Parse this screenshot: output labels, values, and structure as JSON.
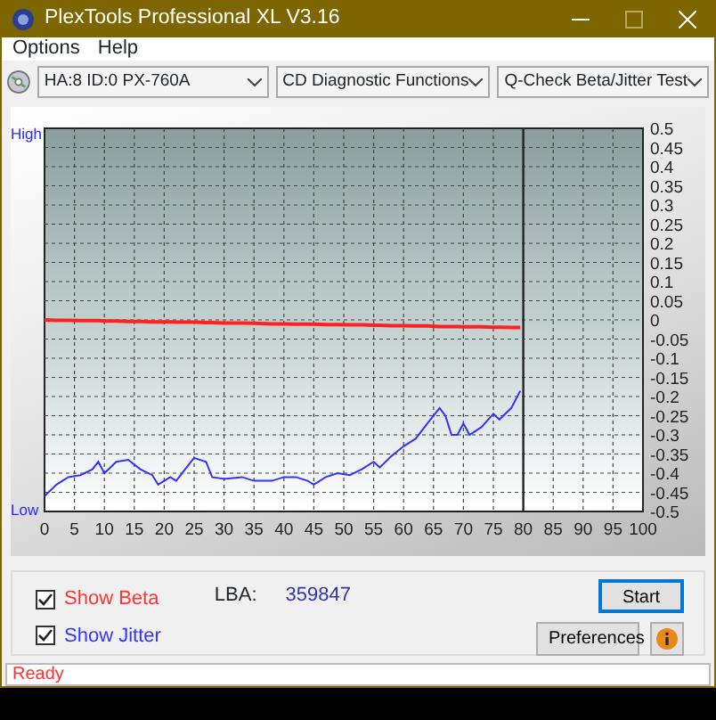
{
  "window": {
    "title": "PlexTools Professional XL V3.16"
  },
  "menu": [
    {
      "label": "Options"
    },
    {
      "label": "Help"
    }
  ],
  "toolbar": [
    {
      "value": "HA:8 ID:0  PX-760A"
    },
    {
      "value": "CD Diagnostic Functions"
    },
    {
      "value": "Q-Check Beta/Jitter Test"
    }
  ],
  "chart": {
    "high_label": "High",
    "low_label": "Low",
    "chart_data": {
      "type": "line",
      "grid": true,
      "ref_lines": [
        {
          "axis": "x",
          "value": 80,
          "color": "#222222"
        }
      ],
      "xlim": [
        0,
        100
      ],
      "ylim": [
        -0.5,
        0.5
      ],
      "xticks": [
        0,
        5,
        10,
        15,
        20,
        25,
        30,
        35,
        40,
        45,
        50,
        55,
        60,
        65,
        70,
        75,
        80,
        85,
        90,
        95,
        100
      ],
      "yticks": [
        0.5,
        0.45,
        0.4,
        0.35,
        0.3,
        0.25,
        0.2,
        0.15,
        0.1,
        0.05,
        0,
        -0.05,
        -0.1,
        -0.15,
        -0.2,
        -0.25,
        -0.3,
        -0.35,
        -0.4,
        -0.45,
        -0.5
      ],
      "x": [
        0,
        2,
        4,
        6,
        8,
        9,
        10,
        12,
        14,
        16,
        18,
        19,
        21,
        22,
        24,
        25,
        27,
        28,
        30,
        33,
        35,
        38,
        40,
        42,
        44,
        45,
        47,
        49,
        51,
        53,
        55,
        56,
        58,
        60,
        62,
        64,
        66,
        67,
        68,
        69,
        70,
        71,
        73,
        75,
        76,
        78,
        79.5
      ],
      "series": [
        {
          "color": "#ff2020",
          "values": [
            0,
            -0.001,
            -0.001,
            -0.002,
            -0.002,
            -0.002,
            -0.003,
            -0.003,
            -0.004,
            -0.004,
            -0.005,
            -0.005,
            -0.005,
            -0.006,
            -0.006,
            -0.006,
            -0.007,
            -0.007,
            -0.008,
            -0.008,
            -0.009,
            -0.01,
            -0.01,
            -0.011,
            -0.011,
            -0.011,
            -0.012,
            -0.012,
            -0.013,
            -0.013,
            -0.014,
            -0.014,
            -0.015,
            -0.015,
            -0.016,
            -0.016,
            -0.017,
            -0.017,
            -0.017,
            -0.017,
            -0.018,
            -0.018,
            -0.018,
            -0.019,
            -0.019,
            -0.02,
            -0.02
          ]
        },
        {
          "color": "#3333ff",
          "values": [
            -0.46,
            -0.43,
            -0.41,
            -0.405,
            -0.39,
            -0.37,
            -0.4,
            -0.37,
            -0.365,
            -0.39,
            -0.405,
            -0.43,
            -0.41,
            -0.42,
            -0.38,
            -0.36,
            -0.37,
            -0.41,
            -0.415,
            -0.41,
            -0.42,
            -0.42,
            -0.41,
            -0.41,
            -0.42,
            -0.43,
            -0.41,
            -0.4,
            -0.405,
            -0.39,
            -0.37,
            -0.385,
            -0.355,
            -0.33,
            -0.31,
            -0.27,
            -0.23,
            -0.25,
            -0.3,
            -0.3,
            -0.27,
            -0.3,
            -0.28,
            -0.245,
            -0.26,
            -0.23,
            -0.185
          ]
        }
      ]
    }
  },
  "options": [
    {
      "label": "Show Beta",
      "checked": true,
      "color": "#ff3333"
    },
    {
      "label": "Show Jitter",
      "checked": true,
      "color": "#3333ff"
    }
  ],
  "lba": {
    "label": "LBA:",
    "value": "359847"
  },
  "buttons": [
    {
      "label": "Start",
      "kind": "default"
    },
    {
      "label": "Preferences",
      "kind": "normal"
    },
    {
      "kind": "info"
    }
  ],
  "status_bar": "Ready"
}
